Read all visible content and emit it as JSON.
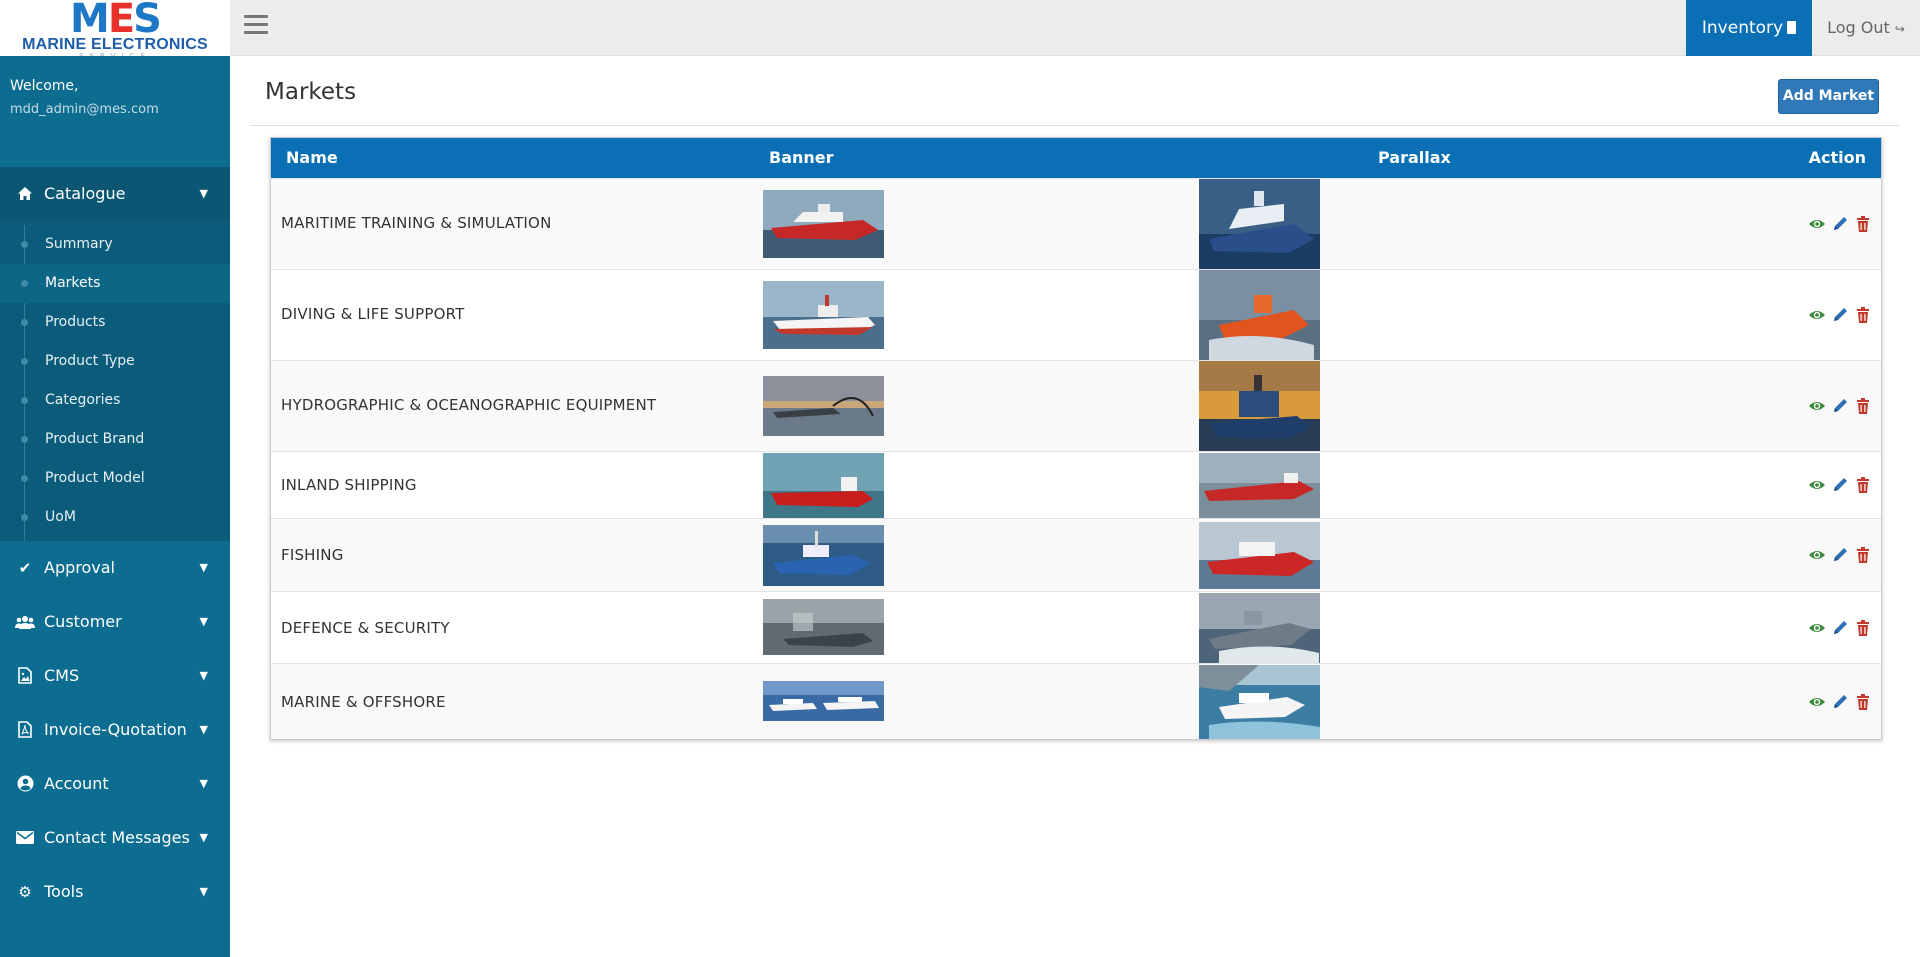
{
  "header": {
    "logo_mark": "MES",
    "logo_text": "MARINE ELECTRONICS",
    "logo_sub": "SERVICE",
    "inventory_label": "Inventory",
    "logout_label": "Log Out"
  },
  "sidebar": {
    "welcome": "Welcome,",
    "email": "mdd_admin@mes.com",
    "catalogue": {
      "label": "Catalogue",
      "icon": "home-icon",
      "items": [
        "Summary",
        "Markets",
        "Products",
        "Product Type",
        "Categories",
        "Product Brand",
        "Product Model",
        "UoM"
      ]
    },
    "sections": [
      {
        "label": "Approval",
        "icon": "check-icon"
      },
      {
        "label": "Customer",
        "icon": "users-icon"
      },
      {
        "label": "CMS",
        "icon": "image-file-icon"
      },
      {
        "label": "Invoice-Quotation",
        "icon": "pdf-file-icon"
      },
      {
        "label": "Account",
        "icon": "user-circle-icon"
      },
      {
        "label": "Contact Messages",
        "icon": "envelope-icon"
      },
      {
        "label": "Tools",
        "icon": "gear-icon"
      }
    ]
  },
  "main": {
    "title": "Markets",
    "add_button": "Add Market",
    "columns": {
      "name": "Name",
      "banner": "Banner",
      "parallax": "Parallax",
      "action": "Action"
    },
    "rows": [
      {
        "name": "MARITIME TRAINING & SIMULATION"
      },
      {
        "name": "DIVING & LIFE SUPPORT"
      },
      {
        "name": "HYDROGRAPHIC & OCEANOGRAPHIC EQUIPMENT"
      },
      {
        "name": "INLAND SHIPPING"
      },
      {
        "name": "FISHING"
      },
      {
        "name": "DEFENCE & SECURITY"
      },
      {
        "name": "MARINE & OFFSHORE"
      }
    ]
  },
  "colors": {
    "sidebar": "#0d6d90",
    "header_accent": "#0a6fb5",
    "view_icon": "#3a8a3a",
    "edit_icon": "#2f6fb3",
    "delete_icon": "#c0392b"
  }
}
